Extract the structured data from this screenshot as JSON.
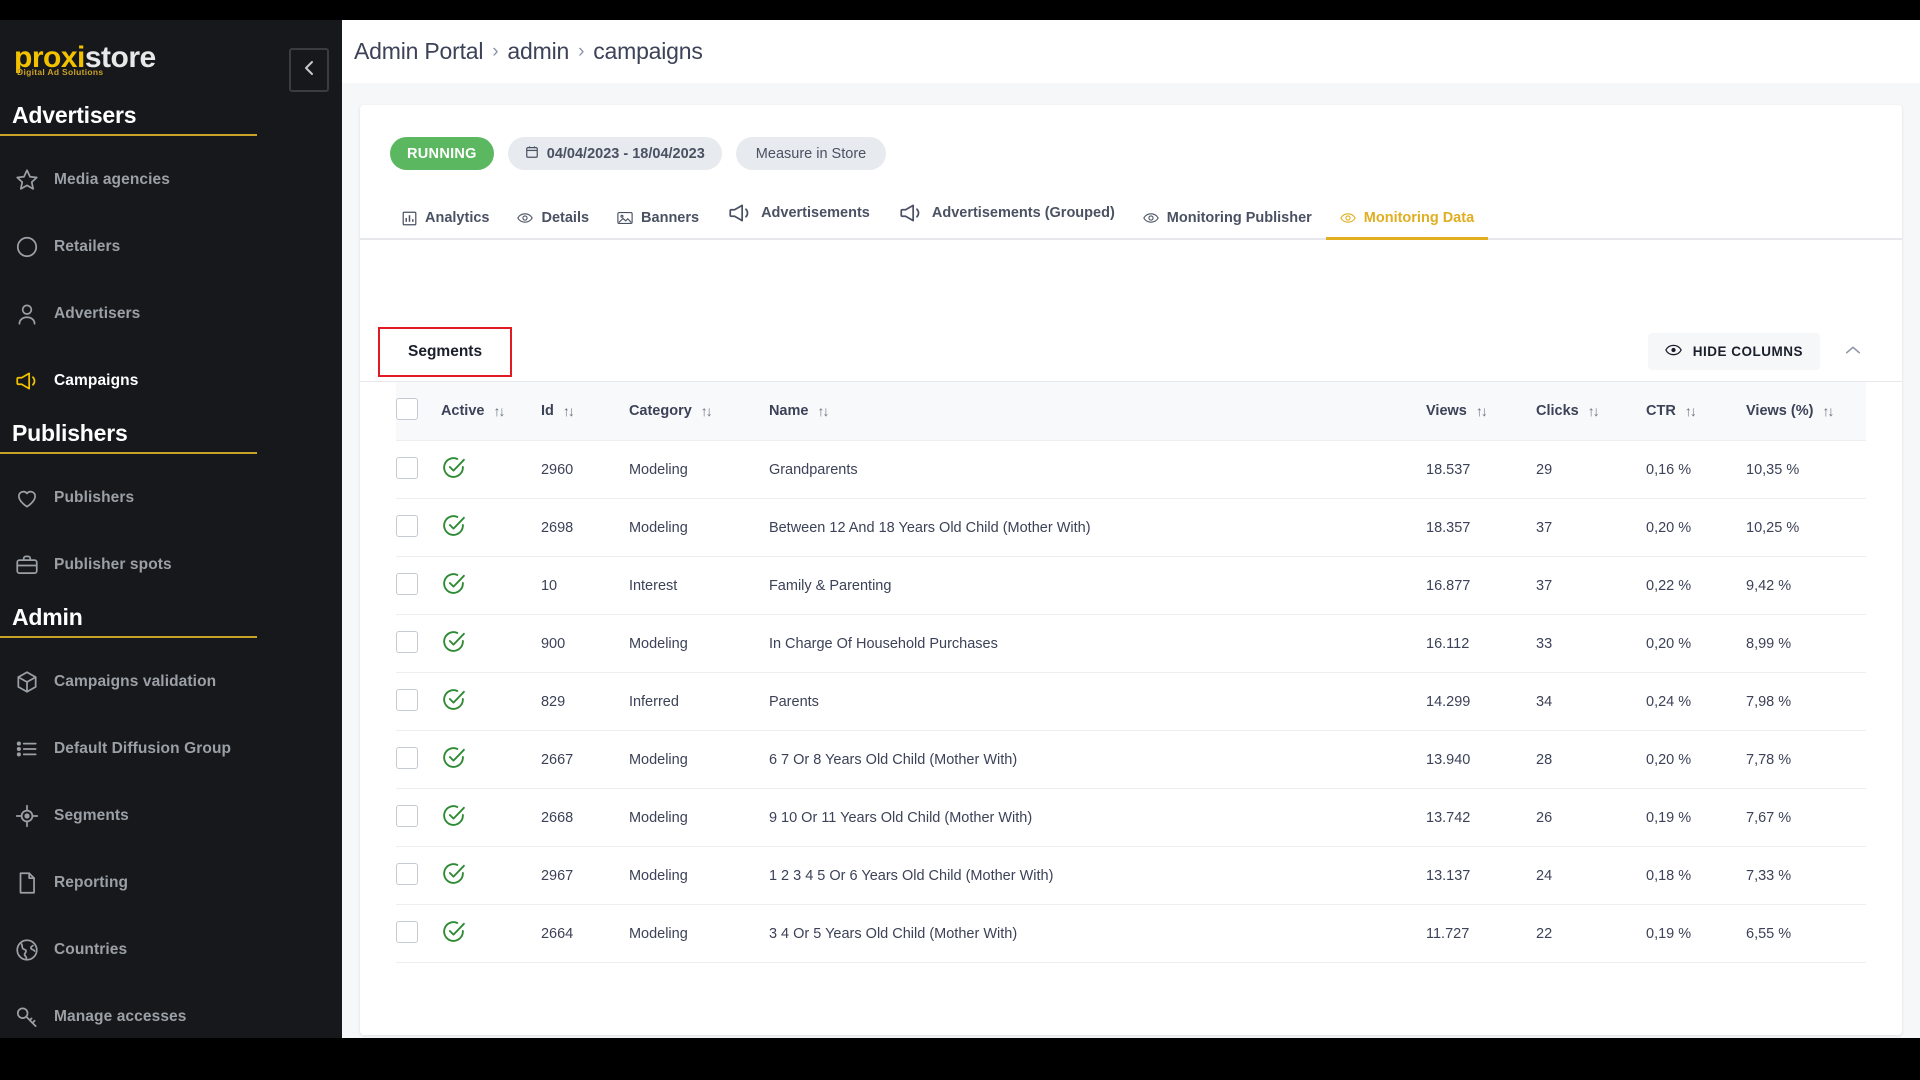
{
  "brand": {
    "logo_part1": "proxi",
    "logo_part2": "store",
    "logo_tagline": "Digital Ad Solutions",
    "accent_yellow": "#f2c200",
    "accent_gold": "#e0ae1f",
    "status_green": "#5cb860",
    "highlight_red": "#e01b24",
    "sidebar_bg": "#17181c"
  },
  "sidebar": {
    "sections": [
      {
        "title": "Advertisers",
        "items": [
          {
            "label": "Media agencies",
            "icon": "star-icon",
            "active": false
          },
          {
            "label": "Retailers",
            "icon": "circle-icon",
            "active": false
          },
          {
            "label": "Advertisers",
            "icon": "user-icon",
            "active": false
          },
          {
            "label": "Campaigns",
            "icon": "megaphone-icon",
            "active": true
          }
        ]
      },
      {
        "title": "Publishers",
        "items": [
          {
            "label": "Publishers",
            "icon": "heart-icon",
            "active": false
          },
          {
            "label": "Publisher spots",
            "icon": "briefcase-icon",
            "active": false
          }
        ]
      },
      {
        "title": "Admin",
        "items": [
          {
            "label": "Campaigns validation",
            "icon": "cube-icon",
            "active": false
          },
          {
            "label": "Default Diffusion Group",
            "icon": "list-icon",
            "active": false
          },
          {
            "label": "Segments",
            "icon": "target-icon",
            "active": false
          },
          {
            "label": "Reporting",
            "icon": "document-icon",
            "active": false
          },
          {
            "label": "Countries",
            "icon": "globe-icon",
            "active": false
          },
          {
            "label": "Manage accesses",
            "icon": "key-icon",
            "active": false
          }
        ]
      }
    ],
    "collapse_icon": "chevron-left-icon"
  },
  "breadcrumb": {
    "items": [
      "Admin Portal",
      "admin",
      "campaigns"
    ],
    "separator": "›"
  },
  "campaign_header": {
    "status": "RUNNING",
    "date_range": "04/04/2023 - 18/04/2023",
    "date_icon": "calendar-icon",
    "measure": "Measure in Store"
  },
  "tabs": [
    {
      "label": "Analytics",
      "icon": "bar-chart-icon",
      "active": false
    },
    {
      "label": "Details",
      "icon": "eye-icon",
      "active": false
    },
    {
      "label": "Banners",
      "icon": "image-icon",
      "active": false
    },
    {
      "label": "Advertisements",
      "icon": "megaphone-icon",
      "active": false
    },
    {
      "label": "Advertisements (Grouped)",
      "icon": "megaphone-icon",
      "active": false
    },
    {
      "label": "Monitoring Publisher",
      "icon": "eye-icon",
      "active": false
    },
    {
      "label": "Monitoring Data",
      "icon": "eye-icon",
      "active": true
    }
  ],
  "panel": {
    "title": "Segments",
    "hide_columns_label": "HIDE COLUMNS",
    "hide_columns_icon": "eye-icon",
    "collapse_icon": "chevron-up-icon"
  },
  "table": {
    "sort_icon": "↑↓",
    "select_all_checked": false,
    "columns": [
      {
        "key": "checkbox",
        "label": "",
        "sortable": false
      },
      {
        "key": "active",
        "label": "Active",
        "sortable": true
      },
      {
        "key": "id",
        "label": "Id",
        "sortable": true
      },
      {
        "key": "category",
        "label": "Category",
        "sortable": true
      },
      {
        "key": "name",
        "label": "Name",
        "sortable": true
      },
      {
        "key": "views",
        "label": "Views",
        "sortable": true
      },
      {
        "key": "clicks",
        "label": "Clicks",
        "sortable": true
      },
      {
        "key": "ctr",
        "label": "CTR",
        "sortable": true
      },
      {
        "key": "views_pct",
        "label": "Views (%)",
        "sortable": true
      }
    ],
    "rows": [
      {
        "checked": false,
        "active": true,
        "id": "2960",
        "category": "Modeling",
        "name": "Grandparents",
        "views": "18.537",
        "clicks": "29",
        "ctr": "0,16 %",
        "views_pct": "10,35 %"
      },
      {
        "checked": false,
        "active": true,
        "id": "2698",
        "category": "Modeling",
        "name": "Between 12 And 18 Years Old Child (Mother With)",
        "views": "18.357",
        "clicks": "37",
        "ctr": "0,20 %",
        "views_pct": "10,25 %"
      },
      {
        "checked": false,
        "active": true,
        "id": "10",
        "category": "Interest",
        "name": "Family & Parenting",
        "views": "16.877",
        "clicks": "37",
        "ctr": "0,22 %",
        "views_pct": "9,42 %"
      },
      {
        "checked": false,
        "active": true,
        "id": "900",
        "category": "Modeling",
        "name": "In Charge Of Household Purchases",
        "views": "16.112",
        "clicks": "33",
        "ctr": "0,20 %",
        "views_pct": "8,99 %"
      },
      {
        "checked": false,
        "active": true,
        "id": "829",
        "category": "Inferred",
        "name": "Parents",
        "views": "14.299",
        "clicks": "34",
        "ctr": "0,24 %",
        "views_pct": "7,98 %"
      },
      {
        "checked": false,
        "active": true,
        "id": "2667",
        "category": "Modeling",
        "name": "6 7 Or 8 Years Old Child (Mother With)",
        "views": "13.940",
        "clicks": "28",
        "ctr": "0,20 %",
        "views_pct": "7,78 %"
      },
      {
        "checked": false,
        "active": true,
        "id": "2668",
        "category": "Modeling",
        "name": "9 10 Or 11 Years Old Child (Mother With)",
        "views": "13.742",
        "clicks": "26",
        "ctr": "0,19 %",
        "views_pct": "7,67 %"
      },
      {
        "checked": false,
        "active": true,
        "id": "2967",
        "category": "Modeling",
        "name": "1 2 3 4 5 Or 6 Years Old Child (Mother With)",
        "views": "13.137",
        "clicks": "24",
        "ctr": "0,18 %",
        "views_pct": "7,33 %"
      },
      {
        "checked": false,
        "active": true,
        "id": "2664",
        "category": "Modeling",
        "name": "3 4 Or 5 Years Old Child (Mother With)",
        "views": "11.727",
        "clicks": "22",
        "ctr": "0,19 %",
        "views_pct": "6,55 %"
      }
    ]
  }
}
